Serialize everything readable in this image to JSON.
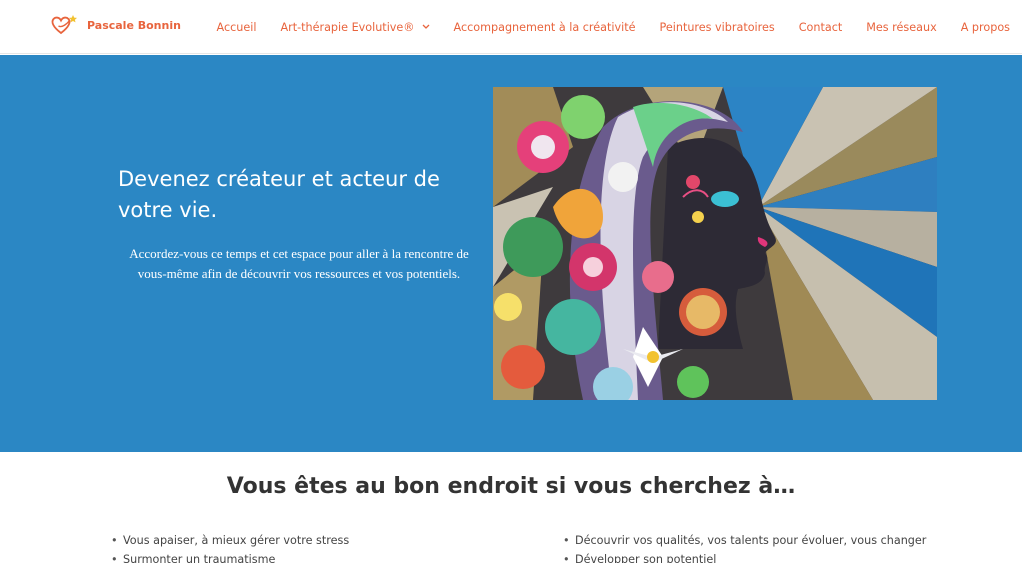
{
  "brand": {
    "name": "Pascale Bonnin",
    "logo_icon": "heart-star-icon",
    "color": "#e8643d"
  },
  "nav": {
    "items": [
      {
        "label": "Accueil"
      },
      {
        "label": "Art-thérapie Evolutive®",
        "has_dropdown": true
      },
      {
        "label": "Accompagnement à la créativité"
      },
      {
        "label": "Peintures vibratoires"
      },
      {
        "label": "Contact"
      },
      {
        "label": "Mes réseaux"
      },
      {
        "label": "A propos"
      }
    ]
  },
  "hero": {
    "background": "#2b87c4",
    "title": "Devenez créateur et acteur de votre vie.",
    "subtitle": "Accordez-vous ce temps et cet espace pour aller à la rencontre de vous-même afin de découvrir vos ressources et vos potentiels.",
    "image": "painting-of-woman-profile-with-flowers"
  },
  "section": {
    "title": "Vous êtes au bon endroit si vous cherchez à…",
    "left_items": [
      "Vous apaiser, à mieux gérer votre stress",
      "Surmonter un traumatisme"
    ],
    "right_items": [
      "Découvrir vos qualités, vos talents pour évoluer, vous changer",
      "Développer son potentiel"
    ]
  }
}
